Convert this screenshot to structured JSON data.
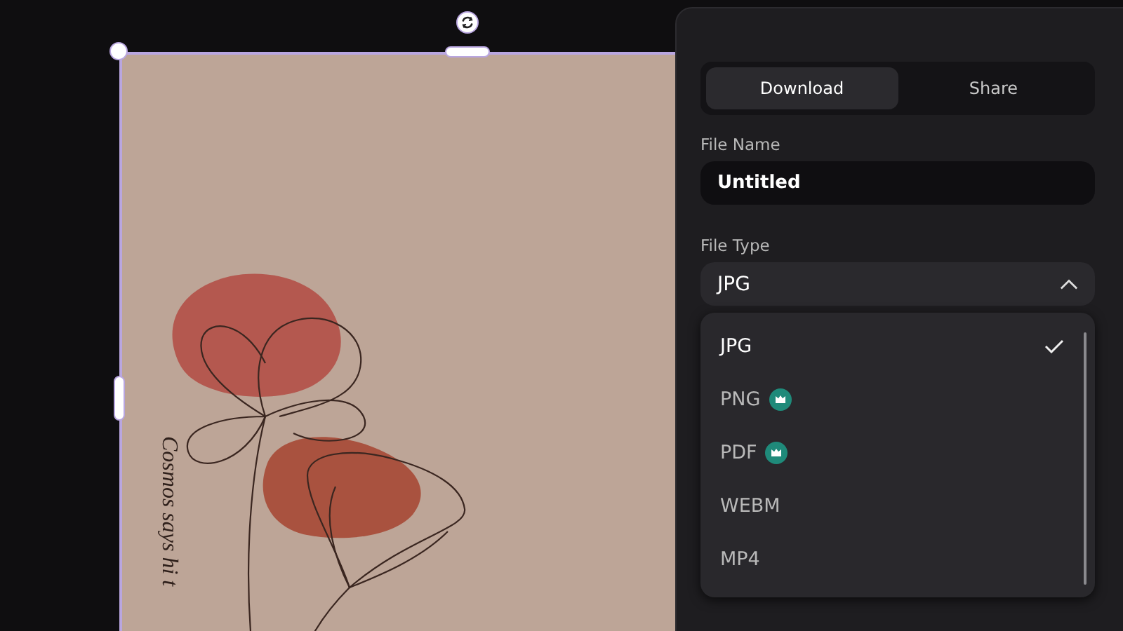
{
  "canvas": {
    "text": "Cosmos says hi t"
  },
  "panel": {
    "tabs": [
      {
        "label": "Download",
        "selected": true
      },
      {
        "label": "Share",
        "selected": false
      }
    ],
    "file_name": {
      "label": "File Name",
      "value": "Untitled"
    },
    "file_type": {
      "label": "File Type",
      "value": "JPG",
      "expanded": true,
      "options": [
        {
          "label": "JPG",
          "selected": true,
          "premium": false
        },
        {
          "label": "PNG",
          "selected": false,
          "premium": true
        },
        {
          "label": "PDF",
          "selected": false,
          "premium": true
        },
        {
          "label": "WEBM",
          "selected": false,
          "premium": false
        },
        {
          "label": "MP4",
          "selected": false,
          "premium": false
        }
      ]
    }
  }
}
